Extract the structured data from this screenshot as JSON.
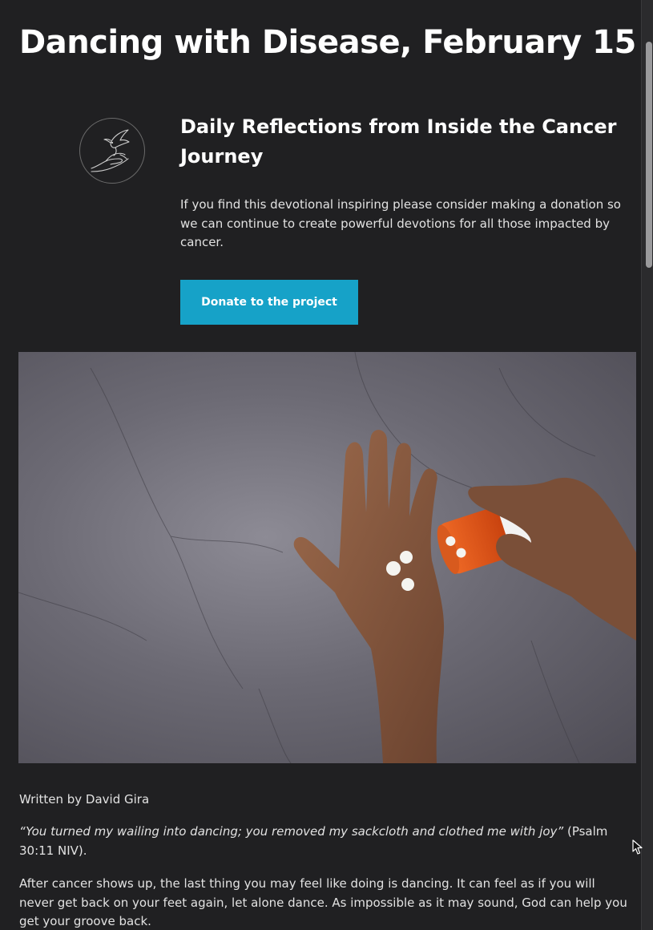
{
  "article": {
    "title": "Dancing with Disease, February 15",
    "series_title": "Daily Reflections from Inside the Cancer Journey",
    "intro": "If you find this devotional inspiring please consider making a donation so we can continue to create powerful devotions for all those impacted by cancer.",
    "donate_label": "Donate to the project",
    "byline": "Written by David Gira",
    "quote_text": "“You turned my wailing into dancing; you removed my sackcloth and clothed me with joy”",
    "quote_ref": " (Psalm 30:11 NIV).",
    "paragraph_1": "After cancer shows up, the last thing you may feel like doing is dancing. It can feel as if you will never get back on your feet again, let alone dance. As impossible as it may sound, God can help you get your groove back."
  },
  "icons": {
    "logo": "dove-over-hand-icon",
    "cursor": "mouse-pointer-icon"
  },
  "colors": {
    "background": "#202022",
    "accent": "#16a2c8",
    "text": "#e2e2e2",
    "pill_bottle": "#e0521c"
  }
}
